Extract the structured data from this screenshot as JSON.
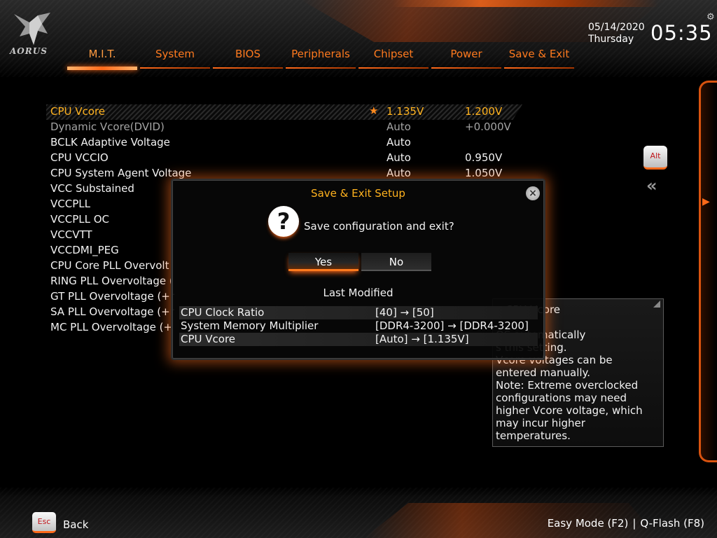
{
  "brand": {
    "logo_text": "AORUS",
    "accent": "#ff6a1a",
    "highlight": "#ffb21e"
  },
  "nav": {
    "items": [
      {
        "label": "M.I.T.",
        "active": true
      },
      {
        "label": "System"
      },
      {
        "label": "BIOS"
      },
      {
        "label": "Peripherals"
      },
      {
        "label": "Chipset"
      },
      {
        "label": "Power"
      },
      {
        "label": "Save & Exit"
      }
    ]
  },
  "datetime": {
    "date": "05/14/2020",
    "day": "Thursday",
    "time": "05:35"
  },
  "settings": {
    "rows": [
      {
        "label": "CPU Vcore",
        "v1": "1.135V",
        "v2": "1.200V",
        "state": "selected",
        "star": "★"
      },
      {
        "label": "Dynamic Vcore(DVID)",
        "v1": "Auto",
        "v2": "+0.000V",
        "state": "dim"
      },
      {
        "label": "BCLK Adaptive Voltage",
        "v1": "Auto",
        "v2": ""
      },
      {
        "label": "CPU VCCIO",
        "v1": "Auto",
        "v2": "0.950V"
      },
      {
        "label": "CPU System Agent Voltage",
        "v1": "Auto",
        "v2": "1.050V"
      },
      {
        "label": "VCC Substained",
        "v1": "",
        "v2": ""
      },
      {
        "label": "VCCPLL",
        "v1": "",
        "v2": ""
      },
      {
        "label": "VCCPLL OC",
        "v1": "",
        "v2": ""
      },
      {
        "label": "VCCVTT",
        "v1": "",
        "v2": ""
      },
      {
        "label": "VCCDMI_PEG",
        "v1": "",
        "v2": ""
      },
      {
        "label": "CPU Core PLL Overvolt",
        "v1": "",
        "v2": ""
      },
      {
        "label": "RING PLL Overvoltage (",
        "v1": "",
        "v2": ""
      },
      {
        "label": "GT PLL Overvoltage (+r",
        "v1": "",
        "v2": ""
      },
      {
        "label": "SA PLL Overvoltage (+r",
        "v1": "",
        "v2": ""
      },
      {
        "label": "MC PLL Overvoltage (+",
        "v1": "",
        "v2": ""
      }
    ]
  },
  "help": {
    "lines": [
      "e CPU Vcore",
      "",
      "OS automatically",
      "s this setting.",
      "Vcore voltages can be",
      "entered manually.",
      "Note: Extreme overclocked",
      "configurations may need",
      "higher Vcore voltage, which",
      "may incur higher",
      "temperatures."
    ]
  },
  "side": {
    "alt_key": "Alt",
    "back_arrows": "«"
  },
  "dialog": {
    "title": "Save & Exit Setup",
    "close": "×",
    "question_icon": "?",
    "question": "Save configuration and exit?",
    "yes": "Yes",
    "no": "No",
    "last_modified": "Last Modified",
    "changes": [
      {
        "name": "CPU Clock Ratio",
        "value": "[40] → [50]"
      },
      {
        "name": "System Memory Multiplier",
        "value": "[DDR4-3200] → [DDR4-3200]"
      },
      {
        "name": "CPU Vcore",
        "value": "[Auto] → [1.135V]"
      }
    ]
  },
  "footer": {
    "esc_key": "Esc",
    "back": "Back",
    "easy_mode": "Easy Mode (F2)",
    "separator": "|",
    "qflash": "Q-Flash (F8)"
  }
}
